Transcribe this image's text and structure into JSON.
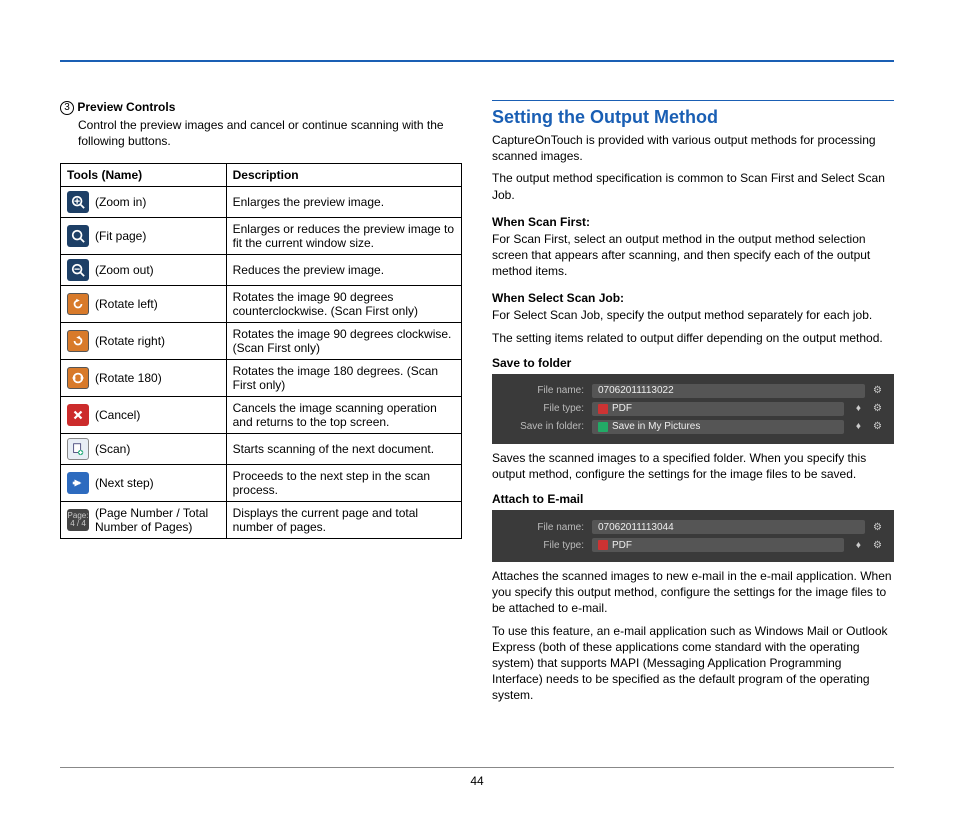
{
  "page_number": "44",
  "left": {
    "heading_number": "3",
    "heading": "Preview Controls",
    "intro": "Control the preview images and cancel or continue scanning with the following buttons.",
    "table": {
      "headers": [
        "Tools (Name)",
        "Description"
      ],
      "rows": [
        {
          "icon": "zoom-in-icon",
          "name": "(Zoom in)",
          "desc": "Enlarges the preview image."
        },
        {
          "icon": "fit-page-icon",
          "name": "(Fit page)",
          "desc": "Enlarges or reduces the preview image to fit the current window size."
        },
        {
          "icon": "zoom-out-icon",
          "name": "(Zoom out)",
          "desc": "Reduces the preview image."
        },
        {
          "icon": "rotate-left-icon",
          "name": "(Rotate left)",
          "desc": "Rotates the image 90 degrees counterclockwise. (Scan First only)"
        },
        {
          "icon": "rotate-right-icon",
          "name": "(Rotate right)",
          "desc": "Rotates the image 90 degrees clockwise. (Scan First only)"
        },
        {
          "icon": "rotate-180-icon",
          "name": "(Rotate 180)",
          "desc": "Rotates the image 180 degrees. (Scan First only)"
        },
        {
          "icon": "cancel-icon",
          "name": "(Cancel)",
          "desc": "Cancels the image scanning operation and returns to the top screen."
        },
        {
          "icon": "scan-icon",
          "name": "(Scan)",
          "desc": "Starts scanning of the next document."
        },
        {
          "icon": "next-step-icon",
          "name": "(Next step)",
          "desc": "Proceeds to the next step in the scan process."
        },
        {
          "icon": "page-count-icon",
          "name": "(Page Number / Total Number of Pages)",
          "desc": "Displays the current page and total number of pages."
        }
      ],
      "page_icon_text_top": "Page:",
      "page_icon_text_bottom": "4 / 4"
    }
  },
  "right": {
    "title": "Setting the Output Method",
    "intro1": "CaptureOnTouch is provided with various output methods for processing scanned images.",
    "intro2": "The output method specification is common to Scan First and Select Scan Job.",
    "scan_first_heading": "When Scan First:",
    "scan_first_body": "For Scan First, select an output method in the output method selection screen that appears after scanning, and then specify each of the output method items.",
    "select_job_heading": "When Select Scan Job:",
    "select_job_body1": "For Select Scan Job, specify the output method separately for each job.",
    "select_job_body2": "The setting items related to output differ depending on the output method.",
    "save_folder_heading": "Save to folder",
    "panel1": {
      "filename_label": "File name:",
      "filename_value": "07062011113022",
      "filetype_label": "File type:",
      "filetype_value": "PDF",
      "savein_label": "Save in folder:",
      "savein_value": "Save in My Pictures"
    },
    "save_folder_body": "Saves the scanned images to a specified folder. When you specify this output method, configure the settings for the image files to be saved.",
    "attach_email_heading": "Attach to E-mail",
    "panel2": {
      "filename_label": "File name:",
      "filename_value": "07062011113044",
      "filetype_label": "File type:",
      "filetype_value": "PDF"
    },
    "attach_email_body1": "Attaches the scanned images to new e-mail in the e-mail application. When you specify this output method, configure the settings for the image files to be attached to e-mail.",
    "attach_email_body2": "To use this feature, an e-mail application such as Windows Mail or Outlook Express (both of these applications come standard with the operating system) that supports MAPI (Messaging Application Programming Interface) needs to be specified as the default program of the operating system."
  }
}
